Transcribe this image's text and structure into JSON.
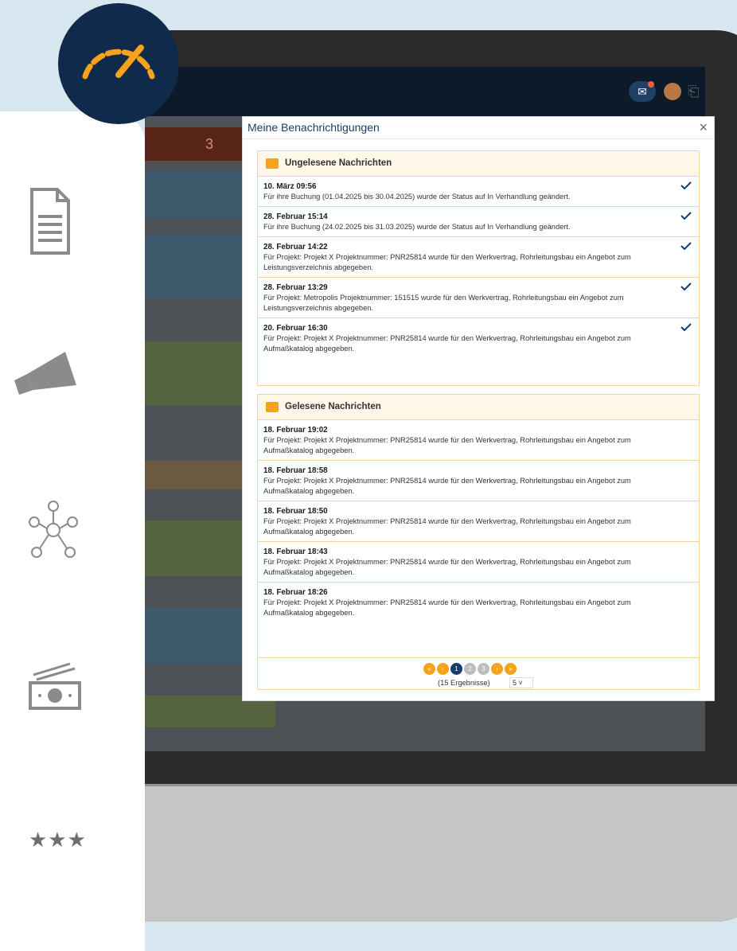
{
  "modal": {
    "title": "Meine Benachrichtigungen",
    "close": "×"
  },
  "background": {
    "counter": "3"
  },
  "unread": {
    "title": "Ungelesene Nachrichten",
    "items": [
      {
        "time": "10. März 09:56",
        "text": "Für ihre Buchung (01.04.2025 bis 30.04.2025) wurde der Status auf In Verhandlung geändert."
      },
      {
        "time": "28. Februar 15:14",
        "text": "Für ihre Buchung (24.02.2025 bis 31.03.2025) wurde der Status auf In Verhandlung geändert."
      },
      {
        "time": "28. Februar 14:22",
        "text": "Für Projekt: Projekt X Projektnummer: PNR25814 wurde für den Werkvertrag, Rohrleitungsbau ein Angebot zum Leistungsverzeichnis abgegeben."
      },
      {
        "time": "28. Februar 13:29",
        "text": "Für Projekt: Metropolis Projektnummer: 151515 wurde für den Werkvertrag, Rohrleitungsbau ein Angebot zum Leistungsverzeichnis abgegeben."
      },
      {
        "time": "20. Februar 16:30",
        "text": "Für Projekt: Projekt X Projektnummer: PNR25814 wurde für den Werkvertrag, Rohrleitungsbau ein Angebot zum Aufmaßkatalog abgegeben."
      }
    ]
  },
  "read": {
    "title": "Gelesene Nachrichten",
    "items": [
      {
        "time": "18. Februar 19:02",
        "text": "Für Projekt: Projekt X Projektnummer: PNR25814 wurde für den Werkvertrag, Rohrleitungsbau ein Angebot zum Aufmaßkatalog abgegeben."
      },
      {
        "time": "18. Februar 18:58",
        "text": "Für Projekt: Projekt X Projektnummer: PNR25814 wurde für den Werkvertrag, Rohrleitungsbau ein Angebot zum Aufmaßkatalog abgegeben."
      },
      {
        "time": "18. Februar 18:50",
        "text": "Für Projekt: Projekt X Projektnummer: PNR25814 wurde für den Werkvertrag, Rohrleitungsbau ein Angebot zum Aufmaßkatalog abgegeben."
      },
      {
        "time": "18. Februar 18:43",
        "text": "Für Projekt: Projekt X Projektnummer: PNR25814 wurde für den Werkvertrag, Rohrleitungsbau ein Angebot zum Aufmaßkatalog abgegeben."
      },
      {
        "time": "18. Februar 18:26",
        "text": "Für Projekt: Projekt X Projektnummer: PNR25814 wurde für den Werkvertrag, Rohrleitungsbau ein Angebot zum Aufmaßkatalog abgegeben."
      }
    ]
  },
  "pagination": {
    "pages": [
      "1",
      "2",
      "3"
    ],
    "active_page": 1,
    "result_text": "(15 Ergebnisse)",
    "per_page": "5"
  },
  "icons": {
    "logo": "speedometer-icon",
    "mail": "envelope-icon",
    "exit": "door-exit-icon",
    "sidebar": [
      "document-icon",
      "megaphone-icon",
      "network-icon",
      "money-icon",
      "stars-icon"
    ]
  },
  "colors": {
    "accent": "#f6a21a",
    "navy": "#173b6a",
    "border": "#f3d6a3"
  }
}
